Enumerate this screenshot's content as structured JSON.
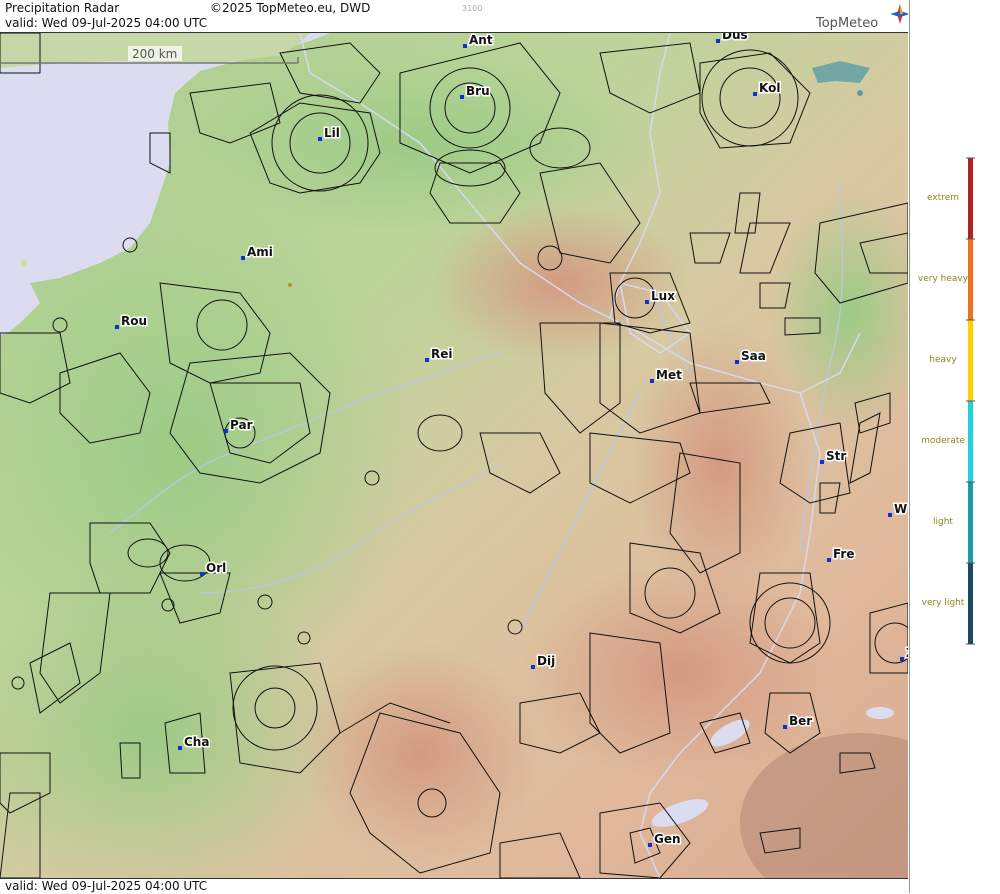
{
  "header": {
    "title": "Precipitation Radar",
    "copyright": "©2025 TopMeteo.eu, DWD",
    "valid": "valid:  Wed  09-Jul-2025 04:00 UTC",
    "code": "3100"
  },
  "logo": {
    "text": "TopMeteo",
    "icon": "compass-star-icon"
  },
  "scale_bar": {
    "label": "200 km"
  },
  "footer": {
    "valid": "valid:  Wed  09-Jul-2025 04:00 UTC"
  },
  "legend": {
    "items": [
      {
        "label": "extrem",
        "color": "#b22222"
      },
      {
        "label": "very heavy",
        "color": "#f07020"
      },
      {
        "label": "heavy",
        "color": "#ffd000"
      },
      {
        "label": "moderate",
        "color": "#20d0e0"
      },
      {
        "label": "light",
        "color": "#2098a8"
      },
      {
        "label": "very light",
        "color": "#1a4a60"
      }
    ]
  },
  "cities": [
    {
      "abbr": "Ant"
    },
    {
      "abbr": "Dus"
    },
    {
      "abbr": "Bru"
    },
    {
      "abbr": "Kol"
    },
    {
      "abbr": "Lil"
    },
    {
      "abbr": "Ami"
    },
    {
      "abbr": "Lux"
    },
    {
      "abbr": "Rou"
    },
    {
      "abbr": "Rei"
    },
    {
      "abbr": "Saa"
    },
    {
      "abbr": "Met"
    },
    {
      "abbr": "Par"
    },
    {
      "abbr": "Str"
    },
    {
      "abbr": "W"
    },
    {
      "abbr": "Fre"
    },
    {
      "abbr": "Orl"
    },
    {
      "abbr": "Dij"
    },
    {
      "abbr": "Ber"
    },
    {
      "abbr": "Cha"
    },
    {
      "abbr": "Gen"
    },
    {
      "abbr": "Z"
    }
  ]
}
